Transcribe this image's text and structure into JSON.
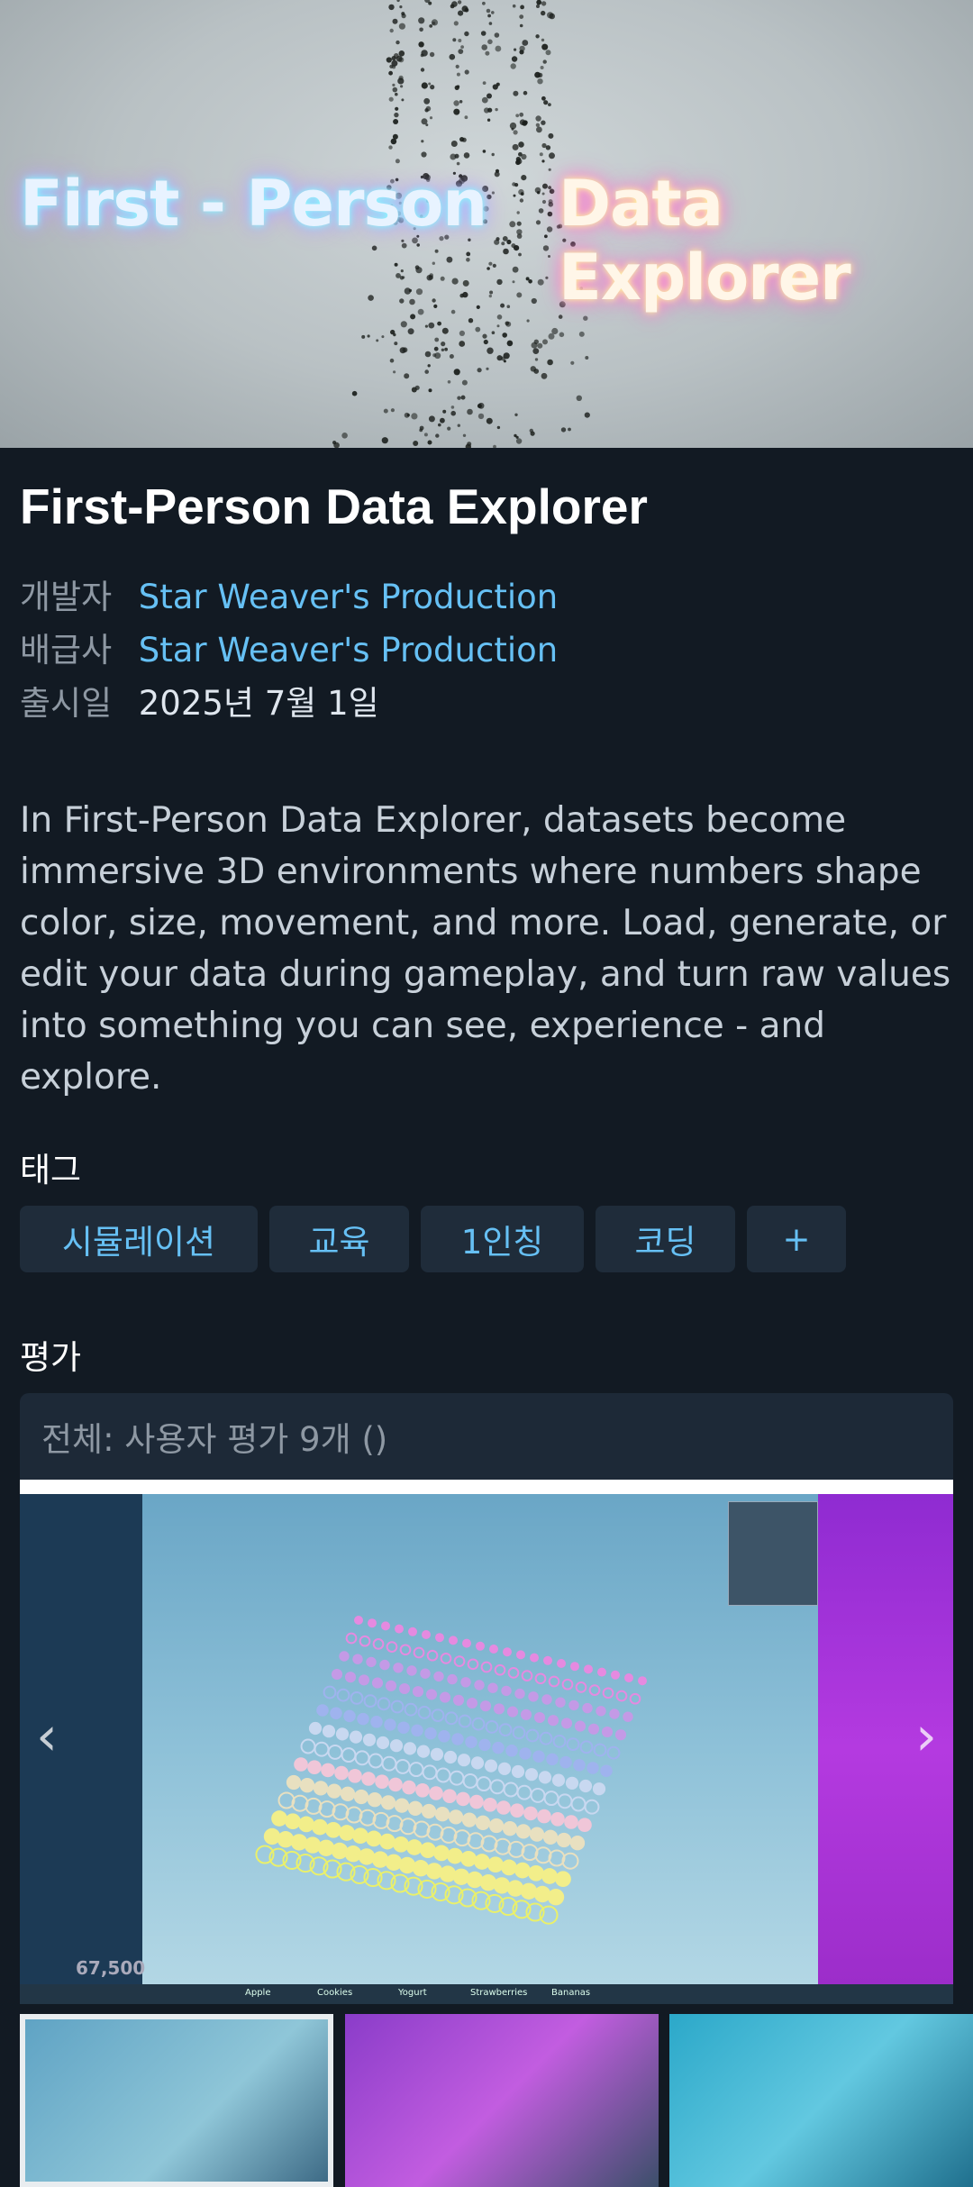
{
  "hero": {
    "left_text": "First - Person",
    "right_text": "Data Explorer"
  },
  "app": {
    "title": "First-Person Data Explorer"
  },
  "meta": [
    {
      "label": "개발자",
      "value": "Star Weaver's Production",
      "is_link": true
    },
    {
      "label": "배급사",
      "value": "Star Weaver's Production",
      "is_link": true
    },
    {
      "label": "출시일",
      "value": "2025년 7월 1일",
      "is_link": false
    }
  ],
  "description": "In First-Person Data Explorer, datasets become immersive 3D environments where numbers shape color, size, movement, and more. Load, generate, or edit your data during gameplay, and turn raw values into something you can see, experience - and explore.",
  "tags_heading": "태그",
  "tags": [
    "시뮬레이션",
    "교육",
    "1인칭",
    "코딩",
    "+"
  ],
  "reviews_heading": "평가",
  "reviews_summary": "전체: 사용자 평가 9개 ()",
  "screenshot": {
    "left_arrow": "‹",
    "right_arrow": "›",
    "count": "67,500",
    "bottom_labels": [
      "Apple",
      "Cookies",
      "Yogurt",
      "Strawberries",
      "Bananas"
    ]
  },
  "colors": {
    "background": "#121a23",
    "link": "#66c0f4",
    "tag_bg": "#1f2c3a"
  }
}
